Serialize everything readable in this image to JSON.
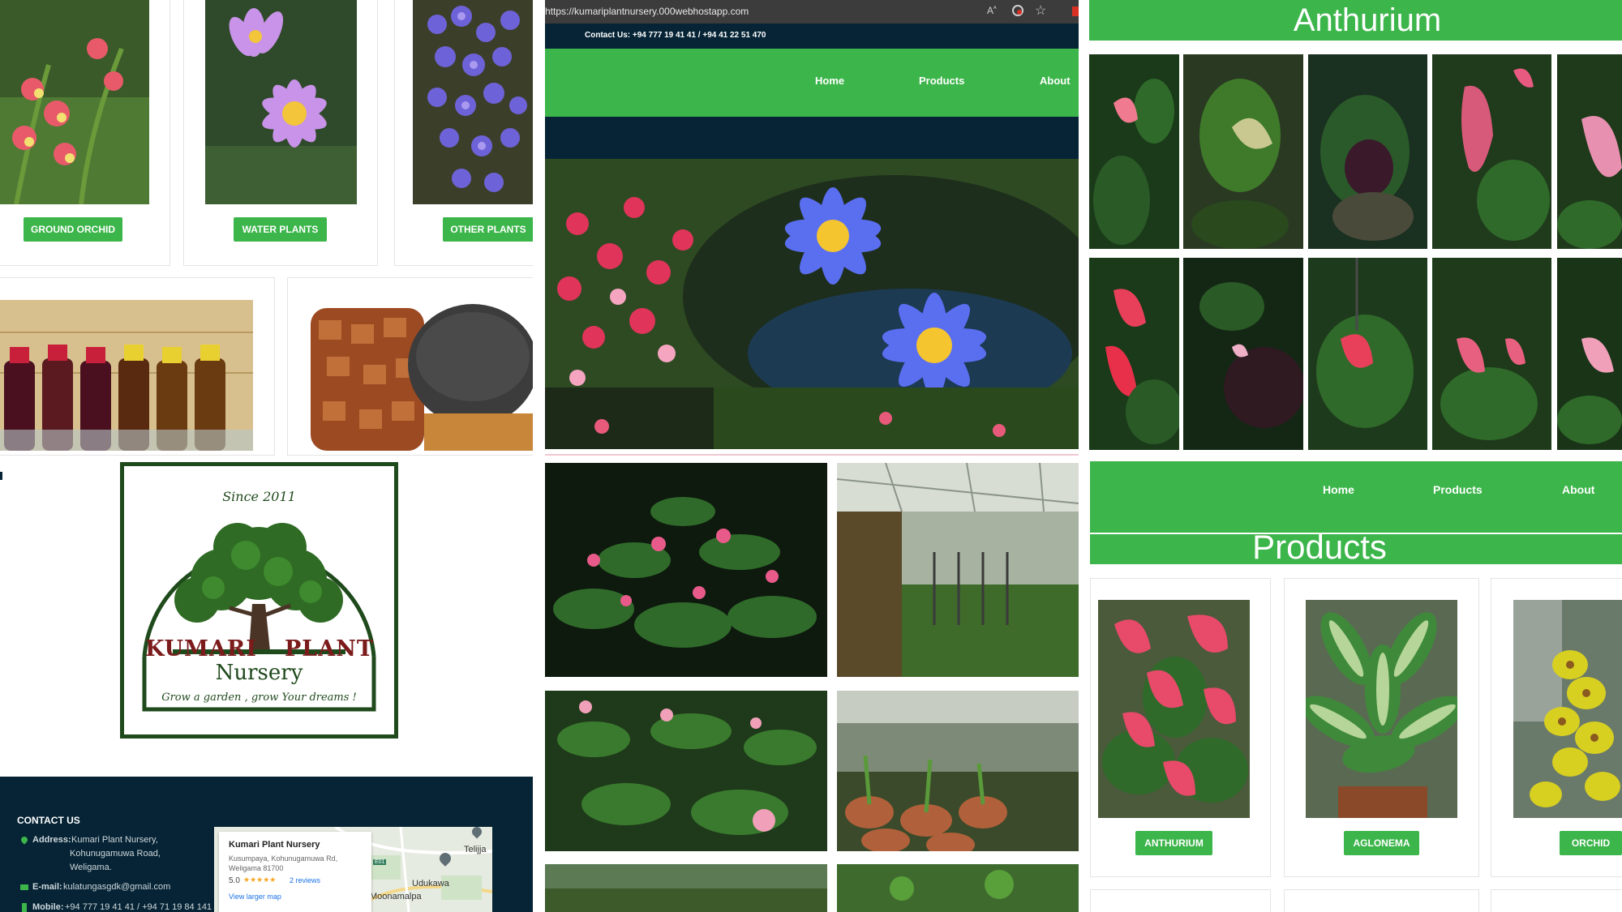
{
  "left_panel": {
    "category_buttons": [
      "GROUND ORCHID",
      "WATER PLANTS",
      "OTHER PLANTS"
    ],
    "logo": {
      "since": "Since 2011",
      "name_left": "KUMARI",
      "name_right": "PLANT",
      "name_sub": "Nursery",
      "tagline": "Grow a garden , grow Your dreams !"
    },
    "footer": {
      "heading": "CONTACT US",
      "address_label": "Address:",
      "address_lines": [
        "Kumari Plant Nursery,",
        "Kohunugamuwa Road,",
        "Weligama."
      ],
      "email_label": "E-mail:",
      "email": "kulatungasgdk@gmail.com",
      "mobile_label": "Mobile:",
      "mobile": "+94 777 19 41 41 / +94 71 19 84 141"
    },
    "map": {
      "place_name": "Kumari Plant Nursery",
      "place_address_1": "Kusumpaya, Kohunugamuwa Rd,",
      "place_address_2": "Weligama 81700",
      "rating": "5.0",
      "stars": "★★★★★",
      "reviews": "2 reviews",
      "larger_map": "View larger map",
      "town_1": "Telijja",
      "town_2": "Udukawa",
      "town_3": "Moonamalpa",
      "road": "E01"
    }
  },
  "center_panel": {
    "url": "https://kumariplantnursery.000webhostapp.com",
    "contact_bar": "Contact Us: +94 777 19 41 41 / +94 41 22 51 470",
    "nav": [
      "Home",
      "Products",
      "About"
    ]
  },
  "right_panel": {
    "anthurium_title": "Anthurium",
    "nav": [
      "Home",
      "Products",
      "About"
    ],
    "products_title": "Products",
    "product_buttons": [
      "ANTHURIUM",
      "AGLONEMA",
      "ORCHID"
    ]
  },
  "colors": {
    "brand_green": "#3cb54a",
    "dark_navy": "#062435",
    "logo_green": "#1f4a1c",
    "logo_red": "#7b1b1b"
  }
}
